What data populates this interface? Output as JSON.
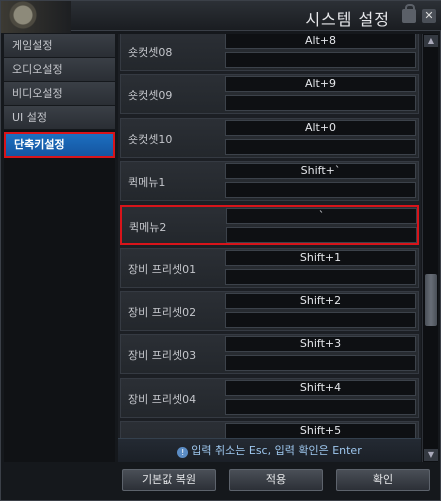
{
  "window": {
    "title": "시스템 설정"
  },
  "menu": {
    "items": [
      {
        "label": "게임설정"
      },
      {
        "label": "오디오설정"
      },
      {
        "label": "비디오설정"
      },
      {
        "label": "UI 설정"
      },
      {
        "label": "단축키설정"
      }
    ]
  },
  "shortcuts": [
    {
      "label": "숏컷셋08",
      "key1": "Alt+8",
      "key2": ""
    },
    {
      "label": "숏컷셋09",
      "key1": "Alt+9",
      "key2": ""
    },
    {
      "label": "숏컷셋10",
      "key1": "Alt+0",
      "key2": ""
    },
    {
      "label": "퀵메뉴1",
      "key1": "Shift+`",
      "key2": ""
    },
    {
      "label": "퀵메뉴2",
      "key1": "`",
      "key2": ""
    },
    {
      "label": "장비 프리셋01",
      "key1": "Shift+1",
      "key2": ""
    },
    {
      "label": "장비 프리셋02",
      "key1": "Shift+2",
      "key2": ""
    },
    {
      "label": "장비 프리셋03",
      "key1": "Shift+3",
      "key2": ""
    },
    {
      "label": "장비 프리셋04",
      "key1": "Shift+4",
      "key2": ""
    },
    {
      "label": "",
      "key1": "Shift+5",
      "key2": ""
    }
  ],
  "hint": {
    "text": "입력 취소는 Esc, 입력 확인은 Enter"
  },
  "buttons": {
    "reset": "기본값 복원",
    "apply": "적용",
    "confirm": "확인"
  },
  "colors": {
    "accent_blue": "#1c6fc0",
    "highlight_red": "#d8141a",
    "hint_text": "#9ec7ee"
  }
}
